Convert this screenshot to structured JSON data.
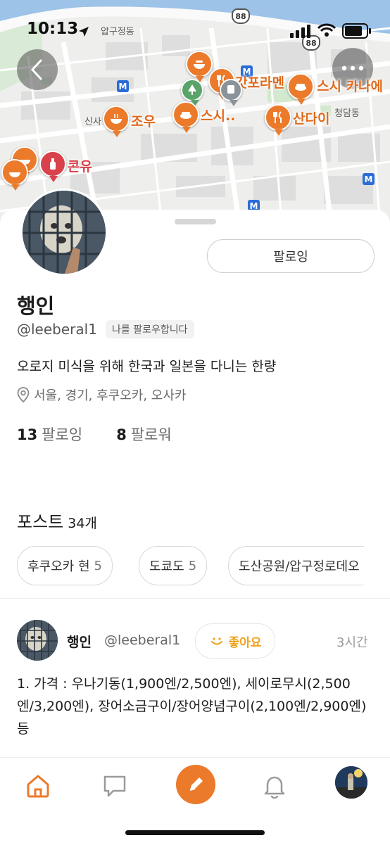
{
  "status_bar": {
    "time": "10:13"
  },
  "map": {
    "areas": [
      "압구정동",
      "신사",
      "청담동"
    ],
    "highway": [
      "88",
      "88"
    ],
    "pins": [
      {
        "name": "갓포라멘",
        "kind": "food"
      },
      {
        "name": "스시 카나에",
        "kind": "sushi"
      },
      {
        "name": "조우",
        "kind": "ramen"
      },
      {
        "name": "스시..",
        "kind": "sushi"
      },
      {
        "name": "산다이",
        "kind": "food"
      },
      {
        "name": "콘유",
        "kind": "bar"
      }
    ],
    "metro_label": "M"
  },
  "profile": {
    "follow_button": "팔로잉",
    "name": "행인",
    "handle": "@leeberal1",
    "follows_me": "나를 팔로우합니다",
    "bio": "오로지 미식을 위해 한국과 일본을 다니는 한량",
    "location": "서울, 경기, 후쿠오카, 오사카",
    "following_count": "13",
    "following_label": "팔로잉",
    "followers_count": "8",
    "followers_label": "팔로워"
  },
  "posts": {
    "title": "포스트",
    "count": "34개",
    "chips": [
      {
        "label": "후쿠오카 현",
        "count": "5"
      },
      {
        "label": "도쿄도",
        "count": "5"
      },
      {
        "label": "도산공원/압구정로데오",
        "count": ""
      }
    ],
    "item": {
      "author": "행인",
      "handle": "@leeberal1",
      "like_label": "좋아요",
      "time": "3시간",
      "body": "1. 가격 : 우나기동(1,900엔/2,500엔), 세이로무시(2,500엔/3,200엔), 장어소금구이/장어양념구이(2,100엔/2,900엔) 등"
    }
  },
  "tabbar": {
    "items": [
      "home",
      "chat",
      "compose",
      "notifications",
      "profile"
    ]
  },
  "colors": {
    "accent": "#ec7a2b",
    "like": "#f0a21a",
    "metro": "#2c6cd6",
    "water": "#9ec3e8"
  }
}
